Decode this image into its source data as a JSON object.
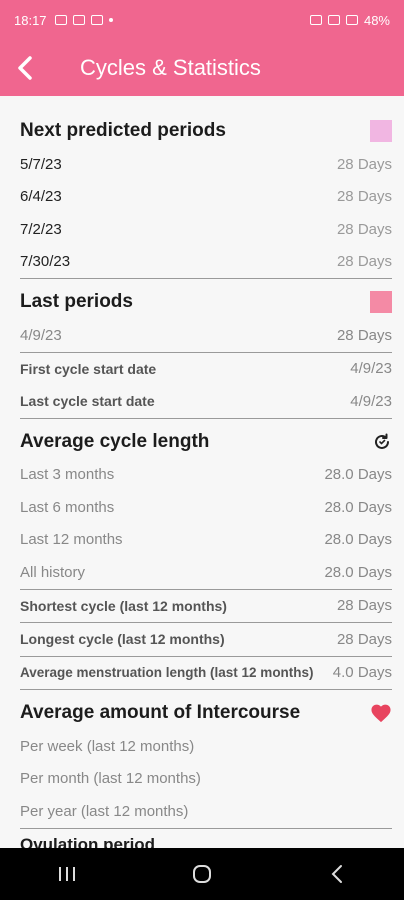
{
  "status": {
    "time": "18:17",
    "battery": "48%"
  },
  "appbar": {
    "title": "Cycles & Statistics"
  },
  "next_predicted": {
    "title": "Next predicted periods",
    "swatch_color": "#f1b6e2",
    "rows": [
      {
        "date": "5/7/23",
        "days": "28 Days"
      },
      {
        "date": "6/4/23",
        "days": "28 Days"
      },
      {
        "date": "7/2/23",
        "days": "28 Days"
      },
      {
        "date": "7/30/23",
        "days": "28 Days"
      }
    ]
  },
  "last_periods": {
    "title": "Last periods",
    "swatch_color": "#f48aa5",
    "row": {
      "date": "4/9/23",
      "days": "28 Days"
    },
    "first_cycle": {
      "label": "First cycle start date",
      "value": "4/9/23"
    },
    "last_cycle": {
      "label": "Last cycle start date",
      "value": "4/9/23"
    }
  },
  "average_cycle": {
    "title": "Average cycle length",
    "rows": [
      {
        "label": "Last 3 months",
        "value": "28.0 Days"
      },
      {
        "label": "Last 6 months",
        "value": "28.0 Days"
      },
      {
        "label": "Last 12 months",
        "value": "28.0 Days"
      },
      {
        "label": "All history",
        "value": "28.0 Days"
      }
    ],
    "shortest": {
      "label": "Shortest cycle (last 12 months)",
      "value": "28 Days"
    },
    "longest": {
      "label": "Longest cycle (last 12 months)",
      "value": "28 Days"
    },
    "menstruation": {
      "label": "Average menstruation length (last 12 months)",
      "value": "4.0 Days"
    }
  },
  "intercourse": {
    "title": "Average amount of Intercourse",
    "heart_color": "#e8445f",
    "rows": [
      {
        "label": "Per week (last 12 months)"
      },
      {
        "label": "Per month (last 12 months)"
      },
      {
        "label": "Per year (last 12 months)"
      }
    ]
  },
  "peek_title": "Ovulation period"
}
